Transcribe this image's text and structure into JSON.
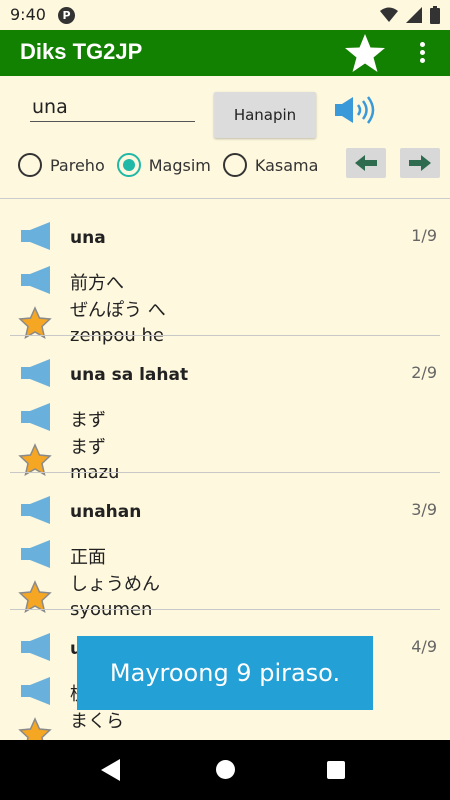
{
  "status": {
    "time": "9:40",
    "notification_icon": "p-badge-icon"
  },
  "app": {
    "title": "Diks TG2JP",
    "accent": "#128000"
  },
  "search": {
    "value": "una",
    "button_label": "Hanapin"
  },
  "modes": [
    {
      "label": "Pareho",
      "checked": false
    },
    {
      "label": "Magsim",
      "checked": true
    },
    {
      "label": "Kasama",
      "checked": false
    }
  ],
  "results": [
    {
      "term": "una",
      "count": "1/9",
      "kanji": "前方へ",
      "kana": "ぜんぽう へ",
      "romaji": "zenpou he"
    },
    {
      "term": "una sa lahat",
      "count": "2/9",
      "kanji": "まず",
      "kana": "まず",
      "romaji": "mazu"
    },
    {
      "term": "unahan",
      "count": "3/9",
      "kanji": "正面",
      "kana": "しょうめん",
      "romaji": "syoumen"
    },
    {
      "term": "u",
      "count": "4/9",
      "kanji": "枕",
      "kana": "まくら",
      "romaji": ""
    }
  ],
  "toast": {
    "message": "Mayroong 9 piraso."
  }
}
